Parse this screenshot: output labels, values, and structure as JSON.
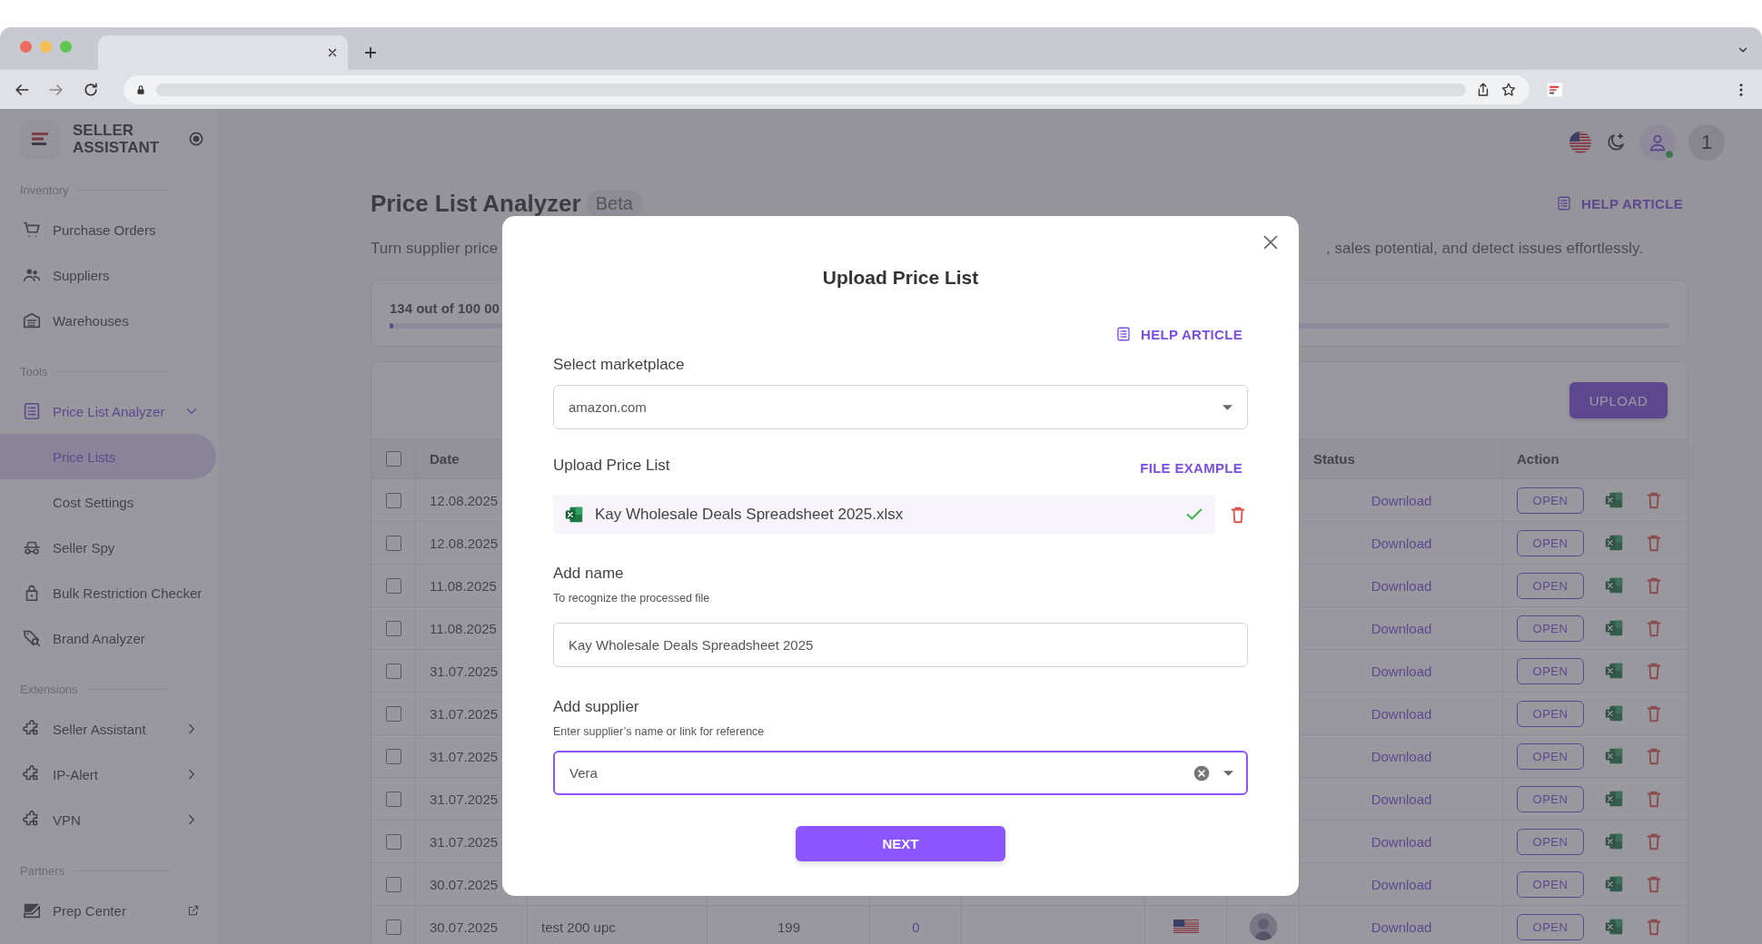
{
  "brand": {
    "name": "SELLER ASSISTANT"
  },
  "header": {
    "notification_count": "1"
  },
  "sidebar": {
    "sections": [
      {
        "title": "Inventory",
        "items": [
          {
            "label": "Purchase Orders",
            "kind": "link",
            "selected": false
          },
          {
            "label": "Suppliers",
            "kind": "link",
            "selected": false
          },
          {
            "label": "Warehouses",
            "kind": "link",
            "selected": false
          }
        ]
      },
      {
        "title": "Tools",
        "items": [
          {
            "label": "Price List Analyzer",
            "kind": "group",
            "selected": false,
            "expanded": true
          },
          {
            "label": "Price Lists",
            "kind": "sub",
            "selected": true
          },
          {
            "label": "Cost Settings",
            "kind": "sub",
            "selected": false
          },
          {
            "label": "Seller Spy",
            "kind": "link",
            "selected": false
          },
          {
            "label": "Bulk Restriction Checker",
            "kind": "link",
            "selected": false
          },
          {
            "label": "Brand Analyzer",
            "kind": "link",
            "selected": false
          }
        ]
      },
      {
        "title": "Extensions",
        "items": [
          {
            "label": "Seller Assistant",
            "kind": "group",
            "selected": false,
            "expanded": false
          },
          {
            "label": "IP-Alert",
            "kind": "group",
            "selected": false,
            "expanded": false
          },
          {
            "label": "VPN",
            "kind": "group",
            "selected": false,
            "expanded": false
          }
        ]
      },
      {
        "title": "Partners",
        "items": [
          {
            "label": "Prep Center",
            "kind": "external",
            "selected": false
          }
        ]
      }
    ]
  },
  "page": {
    "title": "Price List Analyzer",
    "badge": "Beta",
    "help": "HELP ARTICLE",
    "description_start": "Turn supplier price",
    "description_end": ", sales potential, and detect issues effortlessly.",
    "usage": {
      "text": "134 out of 100 00",
      "level": 0.002
    }
  },
  "table": {
    "upload": "UPLOAD",
    "all_checked": false,
    "columns": [
      "Date",
      "Status",
      "Action"
    ],
    "rows": [
      {
        "checked": false,
        "date": "12.08.2025",
        "status": "Download",
        "action": "OPEN"
      },
      {
        "checked": false,
        "date": "12.08.2025",
        "status": "Download",
        "action": "OPEN"
      },
      {
        "checked": false,
        "date": "11.08.2025",
        "status": "Download",
        "action": "OPEN"
      },
      {
        "checked": false,
        "date": "11.08.2025",
        "status": "Download",
        "action": "OPEN"
      },
      {
        "checked": false,
        "date": "31.07.2025",
        "status": "Download",
        "action": "OPEN"
      },
      {
        "checked": false,
        "date": "31.07.2025",
        "status": "Download",
        "action": "OPEN"
      },
      {
        "checked": false,
        "date": "31.07.2025",
        "status": "Download",
        "action": "OPEN"
      },
      {
        "checked": false,
        "date": "31.07.2025",
        "status": "Download",
        "action": "OPEN"
      },
      {
        "checked": false,
        "date": "31.07.2025",
        "status": "Download",
        "action": "OPEN"
      },
      {
        "checked": false,
        "date": "30.07.2025",
        "status": "Download",
        "action": "OPEN"
      },
      {
        "checked": false,
        "date": "30.07.2025",
        "name": "test 200 upc",
        "count": "199",
        "column_5": "0",
        "status": "Download",
        "action": "OPEN"
      }
    ]
  },
  "modal": {
    "title": "Upload Price List",
    "help": "HELP ARTICLE",
    "marketplace": {
      "label": "Select marketplace",
      "value": "amazon.com"
    },
    "upload": {
      "label": "Upload Price List",
      "example": "FILE EXAMPLE",
      "file": "Kay Wholesale Deals Spreadsheet 2025.xlsx",
      "valid": true
    },
    "name": {
      "label": "Add name",
      "hint": "To recognize the processed file",
      "value": "Kay Wholesale Deals Spreadsheet 2025"
    },
    "supplier": {
      "label": "Add supplier",
      "hint": "Enter supplier’s name or link for reference",
      "value": "Vera",
      "focused": true
    },
    "next": "NEXT"
  }
}
